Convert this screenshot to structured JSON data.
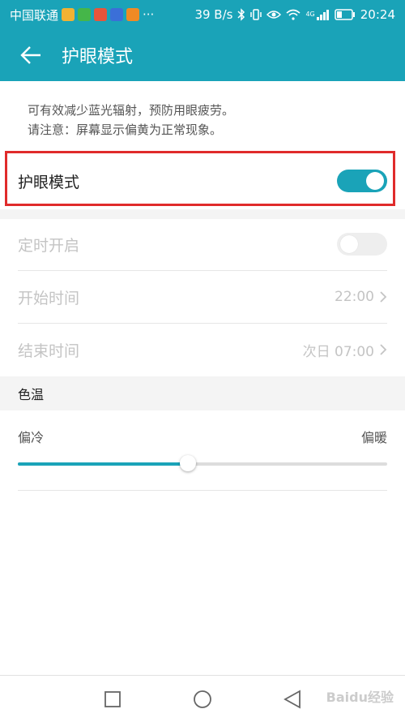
{
  "status_bar": {
    "carrier": "中国联通",
    "overflow": "···",
    "speed": "39 B/s",
    "network_label": "4G",
    "time": "20:24",
    "app_icon_colors": [
      "#f2b233",
      "#45b649",
      "#e8553a",
      "#3b6fd8",
      "#f08a24"
    ]
  },
  "header": {
    "title": "护眼模式",
    "back_icon": "arrow-left-icon"
  },
  "description": {
    "line1": "可有效减少蓝光辐射，预防用眼疲劳。",
    "line2": "请注意：屏幕显示偏黄为正常现象。"
  },
  "settings": {
    "eye_mode": {
      "label": "护眼模式",
      "enabled": true
    },
    "schedule": {
      "label": "定时开启",
      "enabled": false
    },
    "start_time": {
      "label": "开始时间",
      "value": "22:00"
    },
    "end_time": {
      "label": "结束时间",
      "value": "次日 07:00"
    }
  },
  "color_temp": {
    "section_title": "色温",
    "min_label": "偏冷",
    "max_label": "偏暖",
    "level": 0.46
  },
  "nav": {
    "recent_icon": "square-icon",
    "home_icon": "circle-icon",
    "back_icon": "triangle-back-icon"
  },
  "watermark": "Baidu经验",
  "colors": {
    "accent": "#1aa3b8",
    "highlight": "#e02b2b",
    "disabled_text": "#c4c4c4"
  }
}
